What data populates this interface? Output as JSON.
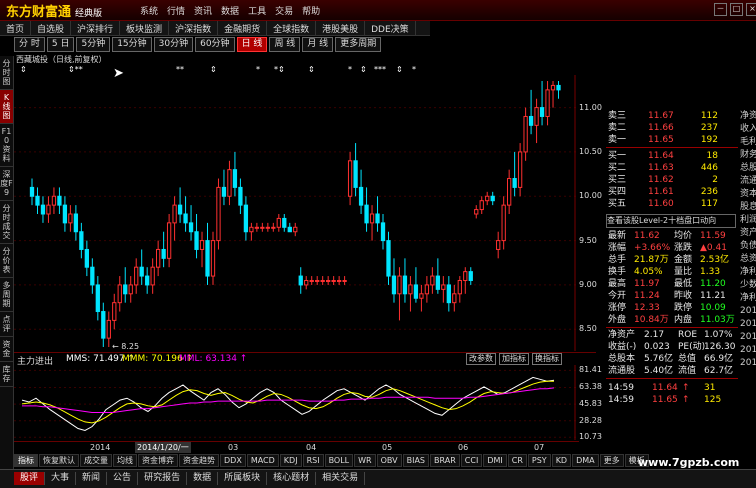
{
  "titlebar": {
    "logo": "东方财富通",
    "edition": "经典版",
    "menu": [
      "系统",
      "行情",
      "资讯",
      "数据",
      "工具",
      "交易",
      "帮助"
    ],
    "win_buttons": [
      "－",
      "□",
      "×"
    ]
  },
  "nav": [
    "首页",
    "自选股",
    "沪深排行",
    "板块监测",
    "沪深指数",
    "金融期货",
    "全球指数",
    "港股美股",
    "DDE决策"
  ],
  "periods": [
    {
      "label": "分 时",
      "active": false
    },
    {
      "label": "5 日",
      "active": false
    },
    {
      "label": "5分钟",
      "active": false
    },
    {
      "label": "15分钟",
      "active": false
    },
    {
      "label": "30分钟",
      "active": false
    },
    {
      "label": "60分钟",
      "active": false
    },
    {
      "label": "日 线",
      "active": true
    },
    {
      "label": "周 线",
      "active": false
    },
    {
      "label": "月 线",
      "active": false
    },
    {
      "label": "更多周期",
      "active": false
    }
  ],
  "sidebar": [
    {
      "label": "分时图",
      "active": false
    },
    {
      "label": "K线图",
      "active": true
    },
    {
      "label": "F10资料",
      "active": false
    },
    {
      "label": "深度F9",
      "active": false
    },
    {
      "label": "分时成交",
      "active": false
    },
    {
      "label": "分价表",
      "active": false
    },
    {
      "label": "多周期",
      "active": false
    },
    {
      "label": "点评",
      "active": false
    },
    {
      "label": "资金",
      "active": false
    },
    {
      "label": "库存",
      "active": false
    }
  ],
  "stock_title": "西藏城投（日线,前复权）",
  "event_marks": [
    "⇕",
    "⇕**",
    "**",
    "⇕",
    "*",
    "*⇕",
    "⇕",
    "*",
    "⇕",
    "***",
    "⇕",
    "*"
  ],
  "main_chart": {
    "y_ticks": [
      "11.00",
      "10.50",
      "10.00",
      "9.50",
      "9.00",
      "8.50"
    ],
    "low_label": "8.25",
    "ylim": [
      8.3,
      11.3
    ]
  },
  "indicator": {
    "name": "主力进出",
    "mms": "MMS: 71.497 ↑",
    "mmm": "MMM: 70.196 ↑",
    "mml": "MML: 63.134 ↑",
    "buttons": [
      "改参数",
      "加指标",
      "换指标"
    ],
    "y_ticks": [
      "81.41",
      "63.38",
      "45.83",
      "28.28",
      "10.73"
    ],
    "ylim": [
      10,
      85
    ]
  },
  "date_axis": {
    "labels": [
      "2014",
      "03",
      "04",
      "05",
      "06",
      "07"
    ],
    "cursor": "2014/1/20/一"
  },
  "indicator_tabs": [
    "指标",
    "恢复默认",
    "成交量",
    "均线",
    "资金博弈",
    "资金趋势",
    "DDX",
    "MACD",
    "KDJ",
    "RSI",
    "BOLL",
    "WR",
    "OBV",
    "BIAS",
    "BRAR",
    "CCI",
    "DMI",
    "CR",
    "PSY",
    "KD",
    "DMA",
    "更多",
    "模板"
  ],
  "bottom_tabs": [
    "股评",
    "大事",
    "新闻",
    "公告",
    "研究报告",
    "数据",
    "所属板块",
    "核心题材",
    "相关交易"
  ],
  "watermark": "www.7gpzb.com",
  "quote": {
    "asks": [
      {
        "label": "卖三",
        "price": "11.67",
        "vol": "112"
      },
      {
        "label": "卖二",
        "price": "11.66",
        "vol": "237"
      },
      {
        "label": "卖一",
        "price": "11.65",
        "vol": "192"
      }
    ],
    "bids": [
      {
        "label": "买一",
        "price": "11.64",
        "vol": "18"
      },
      {
        "label": "买二",
        "price": "11.63",
        "vol": "446"
      },
      {
        "label": "买三",
        "price": "11.62",
        "vol": "2"
      },
      {
        "label": "买四",
        "price": "11.61",
        "vol": "236"
      },
      {
        "label": "买五",
        "price": "11.60",
        "vol": "117"
      }
    ],
    "level2_link": "查看该股Level-2十档盘口动向",
    "stats": [
      {
        "l1": "最新",
        "v1": "11.62",
        "c1": "red",
        "l2": "均价",
        "v2": "11.59",
        "c2": "red"
      },
      {
        "l1": "涨幅",
        "v1": "+3.66%",
        "c1": "red",
        "l2": "涨跌",
        "v2": "▲0.41",
        "c2": "red"
      },
      {
        "l1": "总手",
        "v1": "21.87万",
        "c1": "yel",
        "l2": "金额",
        "v2": "2.53亿",
        "c2": "yel"
      },
      {
        "l1": "换手",
        "v1": "4.05%",
        "c1": "yel",
        "l2": "量比",
        "v2": "1.33",
        "c2": "yel"
      },
      {
        "l1": "最高",
        "v1": "11.97",
        "c1": "red",
        "l2": "最低",
        "v2": "11.20",
        "c2": "grn"
      },
      {
        "l1": "今开",
        "v1": "11.24",
        "c1": "red",
        "l2": "昨收",
        "v2": "11.21",
        "c2": "wht"
      },
      {
        "l1": "涨停",
        "v1": "12.33",
        "c1": "red",
        "l2": "跌停",
        "v2": "10.09",
        "c2": "grn"
      },
      {
        "l1": "外盘",
        "v1": "10.84万",
        "c1": "red",
        "l2": "内盘",
        "v2": "11.03万",
        "c2": "grn"
      }
    ],
    "fund": [
      {
        "l1": "净资产",
        "v1": "2.17",
        "l2": "ROE",
        "v2": "1.07%"
      },
      {
        "l1": "收益(-)",
        "v1": "0.023",
        "l2": "PE(动)",
        "v2": "126.30"
      },
      {
        "l1": "总股本",
        "v1": "5.76亿",
        "l2": "总值",
        "v2": "66.9亿"
      },
      {
        "l1": "流通股",
        "v1": "5.40亿",
        "l2": "流值",
        "v2": "62.7亿"
      }
    ],
    "ticks": [
      {
        "time": "14:59",
        "price": "11.64",
        "arrow": "↑",
        "vol": "31"
      },
      {
        "time": "14:59",
        "price": "11.65",
        "arrow": "↑",
        "vol": "125"
      }
    ]
  },
  "right_cut_labels": [
    "净资",
    "收入",
    "毛利",
    "财务",
    "总股",
    "流通",
    "资本",
    "股息",
    "利润",
    "资产",
    "负债",
    "总资",
    "净利",
    "少数",
    "净利",
    "2014",
    "2014",
    "2014",
    "2014",
    "2017"
  ],
  "chart_data": [
    {
      "type": "candlestick",
      "title": "西藏城投（日线,前复权）",
      "ylim": [
        8.3,
        11.3
      ],
      "note": "approximate daily OHLC read from chart (Jan–Jul 2014)",
      "ohlc": [
        [
          10.1,
          10.2,
          9.9,
          10.0
        ],
        [
          10.0,
          10.1,
          9.8,
          9.9
        ],
        [
          9.9,
          10.0,
          9.7,
          9.8
        ],
        [
          9.8,
          10.0,
          9.7,
          9.9
        ],
        [
          9.9,
          10.1,
          9.8,
          10.0
        ],
        [
          10.0,
          10.1,
          9.8,
          9.9
        ],
        [
          9.9,
          10.0,
          9.6,
          9.7
        ],
        [
          9.7,
          9.9,
          9.6,
          9.8
        ],
        [
          9.8,
          9.9,
          9.5,
          9.6
        ],
        [
          9.6,
          9.7,
          9.3,
          9.4
        ],
        [
          9.4,
          9.5,
          9.1,
          9.2
        ],
        [
          9.2,
          9.3,
          8.9,
          9.0
        ],
        [
          9.0,
          9.1,
          8.6,
          8.7
        ],
        [
          8.7,
          8.8,
          8.3,
          8.4
        ],
        [
          8.4,
          8.7,
          8.3,
          8.6
        ],
        [
          8.6,
          8.9,
          8.5,
          8.8
        ],
        [
          8.8,
          9.1,
          8.7,
          9.0
        ],
        [
          9.0,
          9.2,
          8.8,
          8.9
        ],
        [
          8.9,
          9.1,
          8.8,
          9.0
        ],
        [
          9.0,
          9.3,
          8.9,
          9.2
        ],
        [
          9.2,
          9.4,
          9.0,
          9.1
        ],
        [
          9.1,
          9.2,
          8.9,
          9.0
        ],
        [
          9.0,
          9.3,
          8.9,
          9.2
        ],
        [
          9.2,
          9.5,
          9.1,
          9.4
        ],
        [
          9.4,
          9.6,
          9.2,
          9.3
        ],
        [
          9.3,
          9.8,
          9.2,
          9.7
        ],
        [
          9.7,
          10.0,
          9.5,
          9.9
        ],
        [
          9.9,
          10.1,
          9.7,
          9.8
        ],
        [
          9.8,
          10.0,
          9.6,
          9.7
        ],
        [
          9.7,
          9.9,
          9.5,
          9.6
        ],
        [
          9.6,
          9.8,
          9.3,
          9.4
        ],
        [
          9.4,
          9.6,
          9.2,
          9.5
        ],
        [
          9.5,
          9.7,
          9.0,
          9.1
        ],
        [
          9.1,
          9.6,
          9.0,
          9.5
        ],
        [
          9.5,
          10.2,
          9.4,
          10.1
        ],
        [
          10.1,
          10.3,
          9.9,
          10.0
        ],
        [
          10.0,
          10.4,
          9.9,
          10.3
        ],
        [
          10.3,
          10.5,
          10.0,
          10.1
        ],
        [
          10.1,
          10.2,
          9.8,
          9.9
        ],
        [
          9.9,
          10.0,
          9.5,
          9.6
        ],
        [
          9.6,
          9.7,
          9.5,
          9.65
        ],
        [
          9.65,
          9.7,
          9.6,
          9.65
        ],
        [
          9.65,
          9.7,
          9.6,
          9.65
        ],
        [
          9.65,
          9.7,
          9.6,
          9.65
        ],
        [
          9.65,
          9.7,
          9.6,
          9.65
        ],
        [
          9.65,
          9.8,
          9.6,
          9.75
        ],
        [
          9.75,
          9.8,
          9.6,
          9.65
        ],
        [
          9.65,
          9.7,
          9.6,
          9.6
        ],
        [
          9.6,
          9.7,
          9.55,
          9.65
        ],
        [
          9.1,
          9.2,
          8.9,
          9.0
        ],
        [
          9.0,
          9.1,
          8.95,
          9.05
        ],
        [
          9.05,
          9.1,
          9.0,
          9.05
        ],
        [
          9.05,
          9.1,
          9.0,
          9.05
        ],
        [
          9.05,
          9.1,
          9.0,
          9.05
        ],
        [
          9.05,
          9.1,
          9.0,
          9.05
        ],
        [
          9.05,
          9.1,
          9.0,
          9.05
        ],
        [
          9.05,
          9.1,
          9.0,
          9.05
        ],
        [
          9.05,
          9.1,
          9.0,
          9.05
        ],
        [
          10.0,
          10.5,
          9.9,
          10.4
        ],
        [
          10.4,
          10.6,
          10.0,
          10.1
        ],
        [
          10.1,
          10.3,
          9.8,
          9.9
        ],
        [
          9.9,
          10.1,
          9.6,
          9.7
        ],
        [
          9.7,
          9.9,
          9.5,
          9.8
        ],
        [
          9.8,
          10.0,
          9.6,
          9.7
        ],
        [
          9.7,
          9.8,
          9.4,
          9.5
        ],
        [
          9.5,
          9.6,
          9.0,
          9.1
        ],
        [
          9.1,
          9.3,
          8.8,
          8.9
        ],
        [
          8.9,
          9.2,
          8.6,
          9.1
        ],
        [
          9.1,
          9.3,
          8.8,
          8.9
        ],
        [
          8.9,
          9.1,
          8.7,
          9.0
        ],
        [
          9.0,
          9.2,
          8.8,
          8.85
        ],
        [
          8.85,
          9.0,
          8.7,
          8.9
        ],
        [
          8.9,
          9.1,
          8.8,
          9.0
        ],
        [
          9.0,
          9.2,
          8.9,
          9.1
        ],
        [
          9.1,
          9.3,
          8.9,
          8.95
        ],
        [
          8.95,
          9.1,
          8.8,
          9.0
        ],
        [
          9.0,
          9.1,
          8.7,
          8.8
        ],
        [
          8.8,
          9.0,
          8.7,
          8.9
        ],
        [
          8.9,
          9.1,
          8.8,
          9.05
        ],
        [
          9.05,
          9.2,
          8.9,
          9.15
        ],
        [
          9.15,
          9.2,
          9.0,
          9.05
        ],
        [
          9.8,
          9.9,
          9.75,
          9.85
        ],
        [
          9.85,
          10.0,
          9.8,
          9.95
        ],
        [
          9.95,
          10.05,
          9.9,
          10.0
        ],
        [
          10.0,
          10.05,
          9.9,
          9.95
        ],
        [
          9.4,
          9.6,
          9.3,
          9.5
        ],
        [
          9.5,
          10.0,
          9.4,
          9.9
        ],
        [
          9.9,
          10.3,
          9.8,
          10.2
        ],
        [
          10.2,
          10.5,
          10.0,
          10.1
        ],
        [
          10.1,
          10.6,
          10.0,
          10.5
        ],
        [
          10.5,
          11.0,
          10.4,
          10.9
        ],
        [
          10.9,
          11.2,
          10.7,
          10.8
        ],
        [
          10.8,
          11.1,
          10.6,
          11.0
        ],
        [
          11.0,
          11.3,
          10.8,
          10.9
        ],
        [
          10.9,
          11.3,
          10.8,
          11.2
        ],
        [
          11.2,
          11.3,
          11.0,
          11.25
        ],
        [
          11.25,
          11.3,
          11.1,
          11.2
        ]
      ]
    },
    {
      "type": "line",
      "title": "主力进出",
      "ylim": [
        10,
        85
      ],
      "series": [
        {
          "name": "MMS",
          "color": "#ffffff",
          "values": [
            50,
            48,
            52,
            46,
            40,
            35,
            30,
            25,
            20,
            18,
            22,
            30,
            40,
            45,
            50,
            52,
            48,
            42,
            38,
            44,
            52,
            58,
            62,
            66,
            60,
            55,
            50,
            58,
            62,
            56,
            48,
            42,
            46,
            52,
            58,
            62,
            58,
            50,
            45,
            40,
            35,
            38,
            44,
            50,
            55,
            60,
            62,
            58,
            54,
            50,
            56,
            62,
            66,
            62,
            56,
            52,
            48,
            44,
            40,
            36,
            34,
            40,
            46,
            52,
            56,
            60,
            64,
            60,
            56,
            58,
            62,
            66,
            70,
            74,
            72,
            70,
            71
          ]
        },
        {
          "name": "MMM",
          "color": "#ffff00",
          "values": [
            46,
            47,
            48,
            47,
            45,
            42,
            38,
            34,
            30,
            27,
            26,
            28,
            32,
            37,
            42,
            46,
            47,
            46,
            44,
            43,
            45,
            50,
            55,
            59,
            61,
            60,
            57,
            55,
            57,
            58,
            55,
            51,
            48,
            47,
            50,
            54,
            57,
            56,
            53,
            49,
            45,
            42,
            41,
            43,
            47,
            52,
            56,
            58,
            57,
            54,
            53,
            56,
            60,
            62,
            60,
            57,
            54,
            51,
            48,
            45,
            42,
            40,
            41,
            44,
            48,
            53,
            57,
            59,
            58,
            57,
            58,
            61,
            64,
            67,
            69,
            70,
            70
          ]
        },
        {
          "name": "MML",
          "color": "#ff00ff",
          "values": [
            44,
            44,
            44,
            43,
            43,
            42,
            41,
            40,
            39,
            38,
            37,
            37,
            37,
            37,
            38,
            39,
            40,
            41,
            41,
            42,
            43,
            44,
            45,
            46,
            47,
            47,
            48,
            48,
            49,
            49,
            49,
            49,
            49,
            49,
            49,
            50,
            50,
            50,
            50,
            50,
            50,
            49,
            49,
            49,
            49,
            50,
            50,
            51,
            51,
            51,
            52,
            52,
            53,
            53,
            53,
            53,
            53,
            53,
            53,
            52,
            52,
            52,
            52,
            52,
            53,
            53,
            54,
            55,
            56,
            57,
            58,
            59,
            60,
            61,
            62,
            62,
            63
          ]
        }
      ]
    }
  ]
}
